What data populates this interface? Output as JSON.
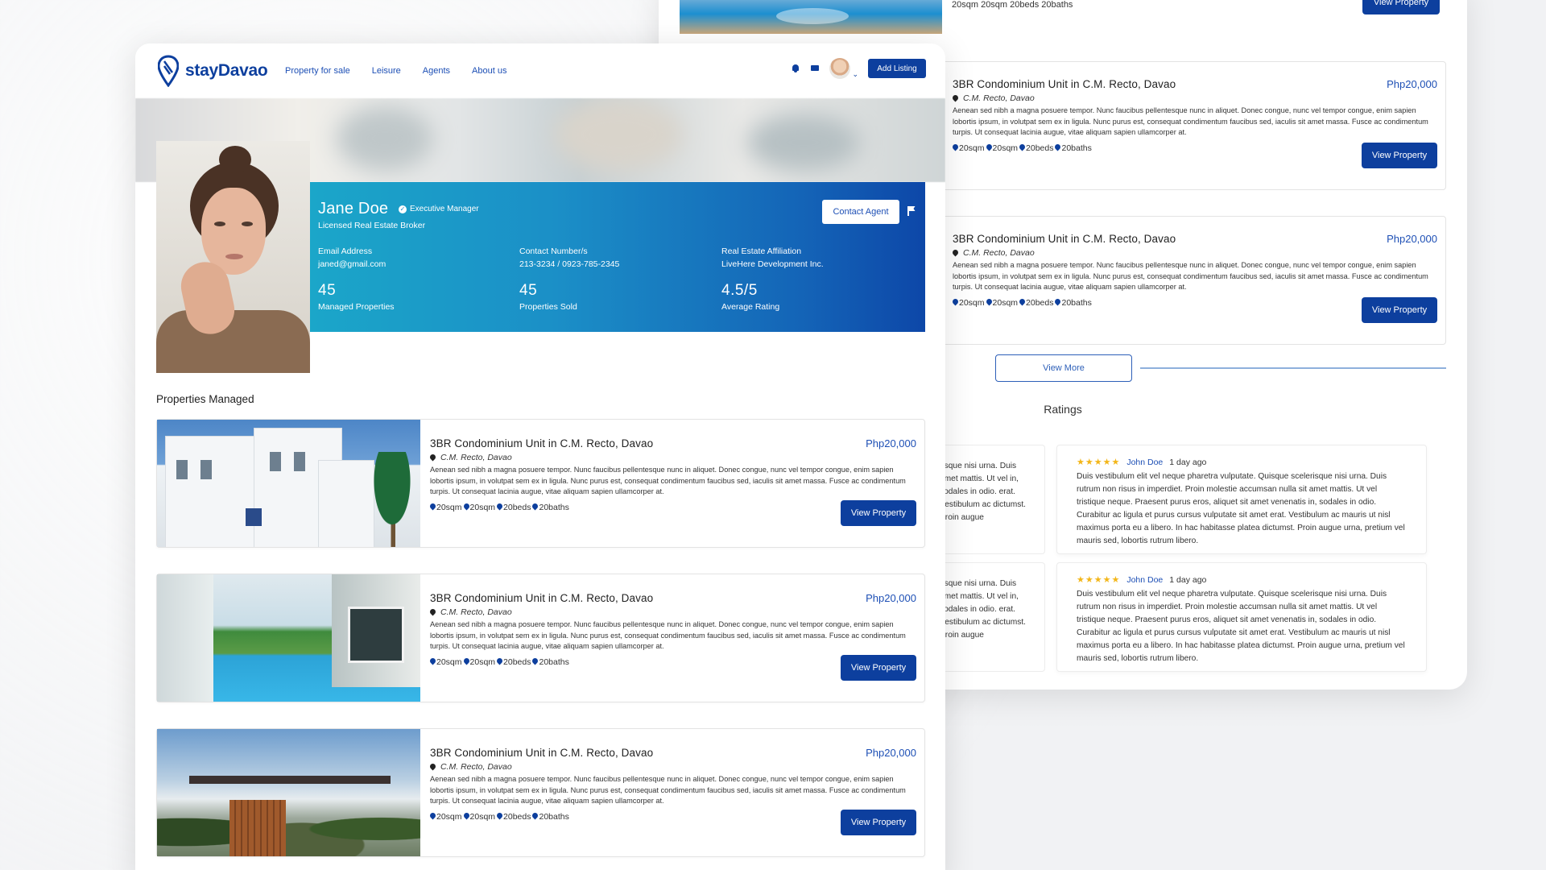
{
  "brand": {
    "name_part1": "stay",
    "name_part2": "Davao",
    "primary_color": "#0d3f9e",
    "accent_color": "#1ba6c9"
  },
  "nav": {
    "links": [
      "Property for sale",
      "Leisure",
      "Agents",
      "About us"
    ],
    "add_listing": "Add Listing"
  },
  "profile": {
    "name": "Jane Doe",
    "badge": "Executive Manager",
    "role": "Licensed Real Estate Broker",
    "contact_button": "Contact Agent",
    "fields": [
      {
        "label": "Email Address",
        "value": "janed@gmail.com"
      },
      {
        "label": "Contact Number/s",
        "value": "213-3234 / 0923-785-2345"
      },
      {
        "label": "Real Estate Affiliation",
        "value": "LiveHere Development Inc."
      }
    ],
    "stats": [
      {
        "value": "45",
        "label": "Managed Properties"
      },
      {
        "value": "45",
        "label": "Properties Sold"
      },
      {
        "value": "4.5/5",
        "label": "Average Rating"
      }
    ]
  },
  "section_title": "Properties Managed",
  "listing": {
    "title": "3BR Condominium Unit in C.M. Recto, Davao",
    "price": "Php20,000",
    "location": "C.M. Recto, Davao",
    "description": "Aenean sed nibh a magna posuere tempor. Nunc faucibus pellentesque nunc in aliquet. Donec congue, nunc vel tempor congue, enim sapien lobortis ipsum, in volutpat sem ex in ligula. Nunc purus est, consequat condimentum faucibus sed, iaculis sit amet massa. Fusce ac condimentum turpis. Ut consequat lacinia augue, vitae aliquam sapien ullamcorper at.",
    "specs": [
      "20sqm",
      "20sqm",
      "20beds",
      "20baths"
    ],
    "button": "View Property"
  },
  "back_page": {
    "top_specs": "20sqm 20sqm 20beds 20baths",
    "top_button": "View Property",
    "view_more": "View More",
    "ratings_title": "Ratings"
  },
  "reviews": [
    {
      "stars": "★★★★★",
      "author": "John Doe",
      "time": "1 day ago",
      "text": "Duis vestibulum elit vel neque pharetra vulputate. Quisque scelerisque nisi urna. Duis rutrum non risus in imperdiet. Proin molestie accumsan nulla sit amet mattis. Ut vel tristique neque. Praesent purus eros, aliquet sit amet venenatis in, sodales in odio. Curabitur ac ligula et purus cursus vulputate sit amet erat. Vestibulum ac mauris ut nisl maximus porta eu a libero. In hac habitasse platea dictumst. Proin augue urna, pretium vel mauris sed, lobortis rutrum libero."
    },
    {
      "stars": "★★★★★",
      "author": "John Doe",
      "time": "1 day ago",
      "text": "Duis vestibulum elit vel neque pharetra vulputate. Quisque scelerisque nisi urna. Duis rutrum non risus in imperdiet. Proin molestie accumsan nulla sit amet mattis. Ut vel tristique neque. Praesent purus eros, aliquet sit amet venenatis in, sodales in odio. Curabitur ac ligula et purus cursus vulputate sit amet erat. Vestibulum ac mauris ut nisl maximus porta eu a libero. In hac habitasse platea dictumst. Proin augue urna, pretium vel mauris sed, lobortis rutrum libero."
    }
  ],
  "partial_review_text": "risque nisi urna. Duis amet mattis. Ut vel in, sodales in odio. erat. Vestibulum ac dictumst. Proin augue"
}
